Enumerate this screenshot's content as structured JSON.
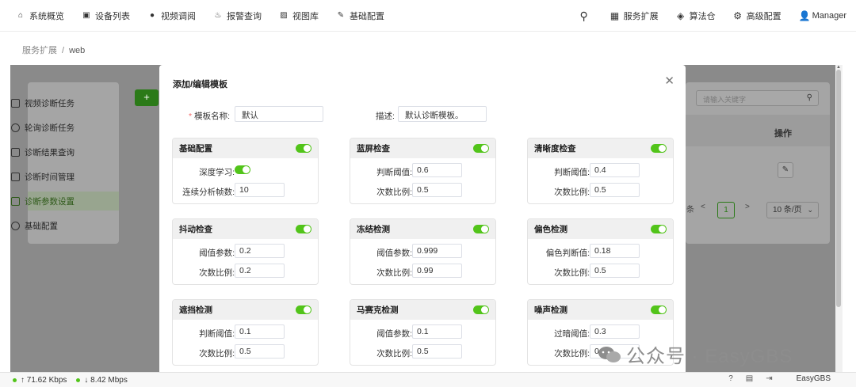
{
  "nav": {
    "items": [
      {
        "label": "系统概览",
        "icon": "home-icon"
      },
      {
        "label": "设备列表",
        "icon": "camera-icon"
      },
      {
        "label": "视频调阅",
        "icon": "play-icon"
      },
      {
        "label": "报警查询",
        "icon": "alarm-icon"
      },
      {
        "label": "视图库",
        "icon": "image-icon"
      },
      {
        "label": "基础配置",
        "icon": "edit-icon"
      }
    ],
    "right": [
      {
        "label": "服务扩展",
        "icon": "grid-icon"
      },
      {
        "label": "算法仓",
        "icon": "box-icon"
      },
      {
        "label": "高级配置",
        "icon": "gear-icon"
      },
      {
        "label": "Manager",
        "icon": "user-icon"
      }
    ]
  },
  "breadcrumb": {
    "root": "服务扩展",
    "sep": "/",
    "current": "web"
  },
  "sidebar": {
    "items": [
      {
        "label": "视频诊断任务"
      },
      {
        "label": "轮询诊断任务"
      },
      {
        "label": "诊断结果查询"
      },
      {
        "label": "诊断时间管理"
      },
      {
        "label": "诊断参数设置",
        "active": true
      },
      {
        "label": "基础配置"
      }
    ]
  },
  "background": {
    "add_button": "+",
    "search_placeholder": "请输入关键字",
    "column_operation": "操作",
    "pager_tail": "条",
    "pager_prev": "<",
    "pager_current": "1",
    "pager_next": ">",
    "page_size": "10 条/页"
  },
  "modal": {
    "title": "添加/编辑模板",
    "name_label": "模板名称:",
    "name_value": "默认",
    "desc_label": "描述:",
    "desc_value": "默认诊断模板。",
    "cards": [
      {
        "title": "基础配置",
        "enabled": true,
        "rows": [
          {
            "label": "深度学习:",
            "toggle": true
          },
          {
            "label": "连续分析帧数:",
            "value": "10"
          }
        ]
      },
      {
        "title": "蓝屏检查",
        "enabled": true,
        "rows": [
          {
            "label": "判断阈值:",
            "value": "0.6"
          },
          {
            "label": "次数比例:",
            "value": "0.5"
          }
        ]
      },
      {
        "title": "清晰度检查",
        "enabled": true,
        "rows": [
          {
            "label": "判断阈值:",
            "value": "0.4"
          },
          {
            "label": "次数比例:",
            "value": "0.5"
          }
        ]
      },
      {
        "title": "抖动检查",
        "enabled": true,
        "rows": [
          {
            "label": "阈值参数:",
            "value": "0.2"
          },
          {
            "label": "次数比例:",
            "value": "0.2"
          }
        ]
      },
      {
        "title": "冻结检测",
        "enabled": true,
        "rows": [
          {
            "label": "阈值参数:",
            "value": "0.999"
          },
          {
            "label": "次数比例:",
            "value": "0.99"
          }
        ]
      },
      {
        "title": "偏色检测",
        "enabled": true,
        "rows": [
          {
            "label": "偏色判断值:",
            "value": "0.18"
          },
          {
            "label": "次数比例:",
            "value": "0.5"
          }
        ]
      },
      {
        "title": "遮挡检测",
        "enabled": true,
        "rows": [
          {
            "label": "判断阈值:",
            "value": "0.1"
          },
          {
            "label": "次数比例:",
            "value": "0.5"
          }
        ]
      },
      {
        "title": "马赛克检测",
        "enabled": true,
        "rows": [
          {
            "label": "阈值参数:",
            "value": "0.1"
          },
          {
            "label": "次数比例:",
            "value": "0.5"
          }
        ]
      },
      {
        "title": "噪声检测",
        "enabled": true,
        "rows": [
          {
            "label": "过暗阈值:",
            "value": "0.3"
          },
          {
            "label": "次数比例:",
            "value": "0.6"
          }
        ]
      }
    ]
  },
  "footer": {
    "upload": "↑ 71.62 Kbps",
    "download": "↓ 8.42 Mbps",
    "brand": "EasyGBS"
  },
  "watermark": "公众号 · EasyGBS",
  "colors": {
    "accent": "#52c41a",
    "brand_green": "#2b7a18",
    "required": "#f56c6c"
  }
}
